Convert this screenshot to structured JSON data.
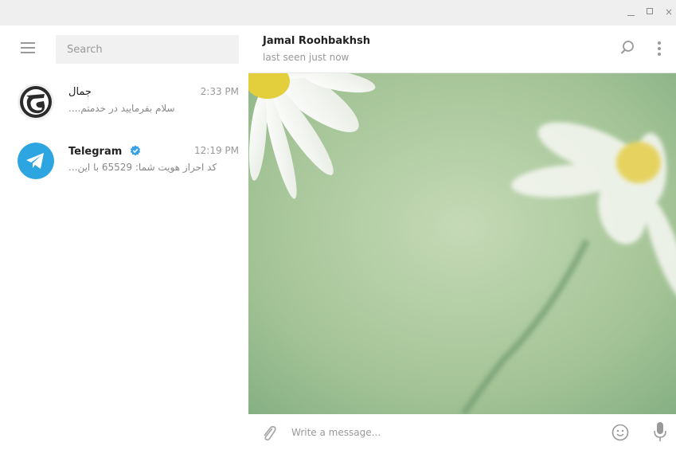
{
  "window": {
    "controls": [
      "minimize-icon",
      "maximize-icon",
      "close-icon"
    ],
    "close_label": "×"
  },
  "sidebar": {
    "search": {
      "placeholder": "Search",
      "value": ""
    },
    "dialogs": [
      {
        "name": "جمال",
        "time": "2:33 PM",
        "preview": "سلام بفرمایید در خدمتم....",
        "avatar": "app-logo-avatar"
      },
      {
        "name": "Telegram",
        "verified": true,
        "time": "12:19 PM",
        "preview": "کد احراز هویت شما: 65529 با این...",
        "avatar": "telegram-avatar"
      }
    ]
  },
  "chat": {
    "peer_name": "Jamal Roohbakhsh",
    "peer_status": "last seen just now",
    "composer_placeholder": "Write a message..."
  },
  "colors": {
    "accent": "#2ca5e0",
    "titlebar": "#efefef",
    "search_bg": "#f1f1f1",
    "wallpaper_green": "#a9c99b"
  }
}
